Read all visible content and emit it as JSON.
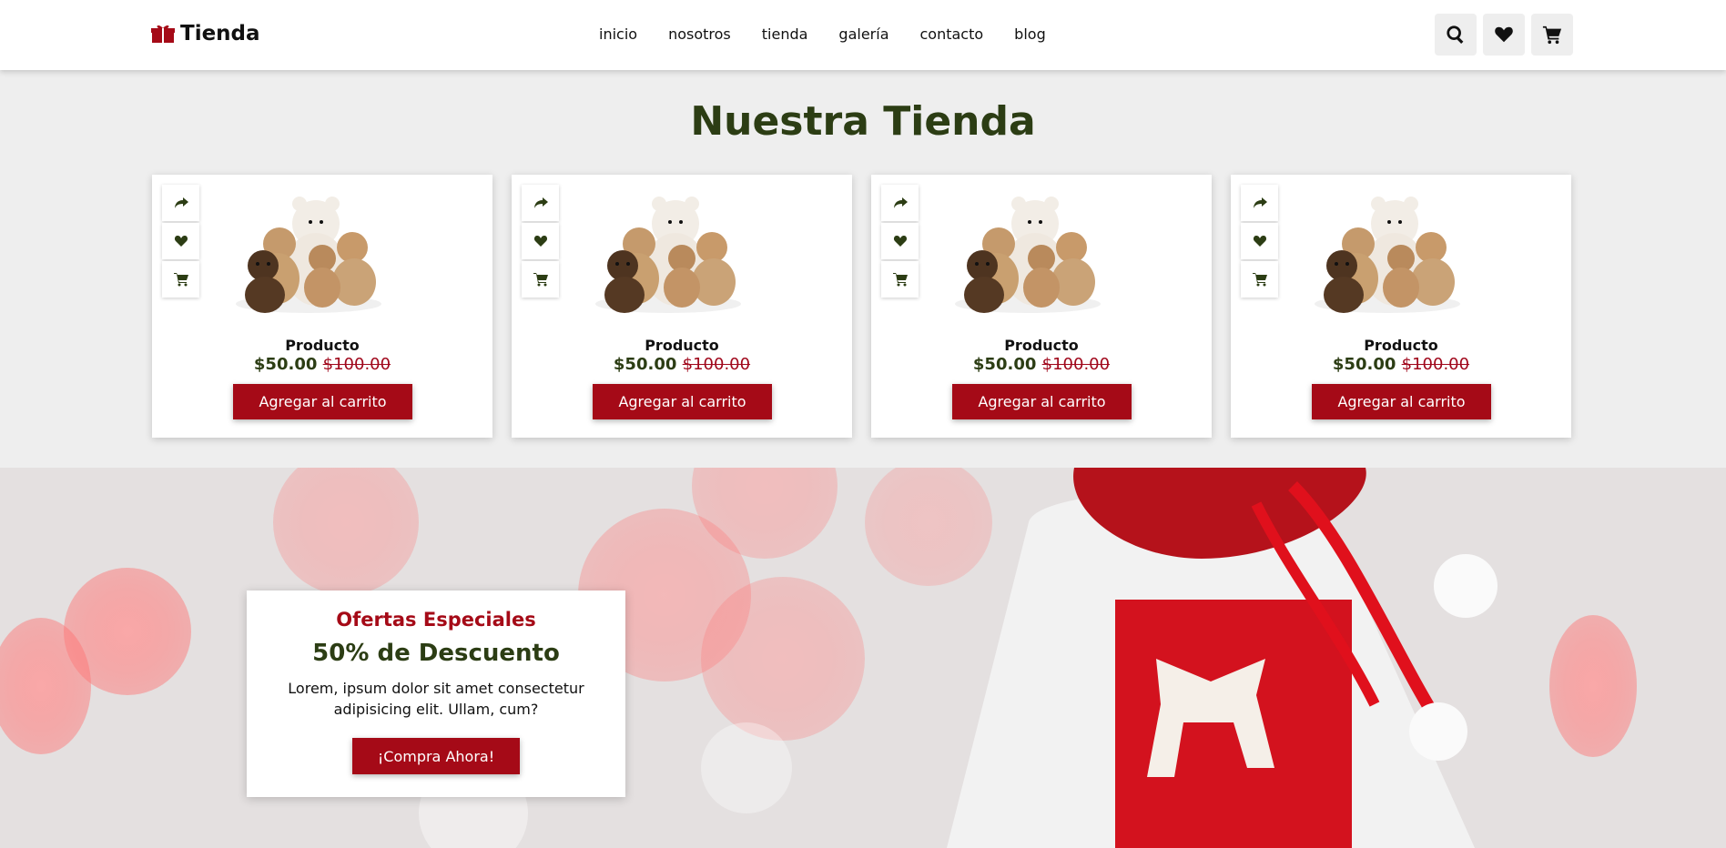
{
  "header": {
    "logo_text": "Tienda",
    "nav": [
      "inicio",
      "nosotros",
      "tienda",
      "galería",
      "contacto",
      "blog"
    ],
    "icons": [
      "search-icon",
      "heart-icon",
      "cart-icon"
    ]
  },
  "store": {
    "title": "Nuestra Tienda",
    "products": [
      {
        "name": "Producto",
        "price": "$50.00",
        "old_price": "$100.00",
        "button": "Agregar al carrito"
      },
      {
        "name": "Producto",
        "price": "$50.00",
        "old_price": "$100.00",
        "button": "Agregar al carrito"
      },
      {
        "name": "Producto",
        "price": "$50.00",
        "old_price": "$100.00",
        "button": "Agregar al carrito"
      },
      {
        "name": "Producto",
        "price": "$50.00",
        "old_price": "$100.00",
        "button": "Agregar al carrito"
      }
    ],
    "card_icons": [
      "share-icon",
      "heart-icon",
      "cart-icon"
    ]
  },
  "offer": {
    "subtitle": "Ofertas Especiales",
    "title": "50% de Descuento",
    "text": "Lorem, ipsum dolor sit amet consectetur adipisicing elit. Ullam, cum?",
    "button": "¡Compra Ahora!"
  },
  "colors": {
    "accent_red": "#a50a17",
    "dark_green": "#2c3d14",
    "background": "#eeeeee"
  }
}
